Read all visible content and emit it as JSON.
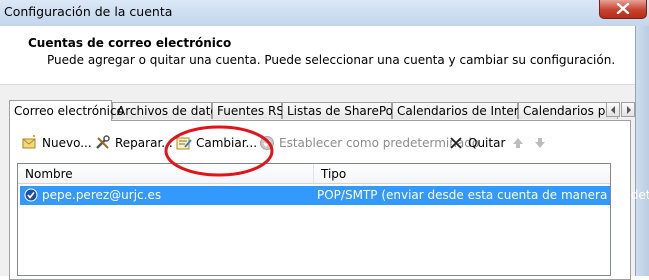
{
  "window": {
    "title": "Configuración de la cuenta"
  },
  "header": {
    "title": "Cuentas de correo electrónico",
    "description": "Puede agregar o quitar una cuenta. Puede seleccionar una cuenta y cambiar su configuración."
  },
  "tabs": [
    {
      "label": "Correo electrónico",
      "active": true
    },
    {
      "label": "Archivos de datos"
    },
    {
      "label": "Fuentes RSS"
    },
    {
      "label": "Listas de SharePoint"
    },
    {
      "label": "Calendarios de Internet"
    },
    {
      "label": "Calendarios publi"
    }
  ],
  "toolbar": {
    "new_label": "Nuevo...",
    "repair_label": "Reparar...",
    "change_label": "Cambiar...",
    "set_default_label": "Establecer como predeterminado",
    "remove_label": "Quitar",
    "icons": {
      "new": "mail-new-icon",
      "repair": "tools-icon",
      "change": "edit-account-icon",
      "set_default": "check-circle-icon",
      "remove": "x-icon",
      "move_up": "arrow-up-icon",
      "move_down": "arrow-down-icon"
    }
  },
  "accounts_list": {
    "columns": [
      "Nombre",
      "Tipo"
    ],
    "rows": [
      {
        "name": "pepe.perez@urjc.es",
        "type": "POP/SMTP (enviar desde esta cuenta de manera predet..."
      }
    ]
  },
  "colors": {
    "selection": "#3399ff",
    "highlight_ellipse": "#e0141a",
    "close_button": "#c7422f"
  }
}
